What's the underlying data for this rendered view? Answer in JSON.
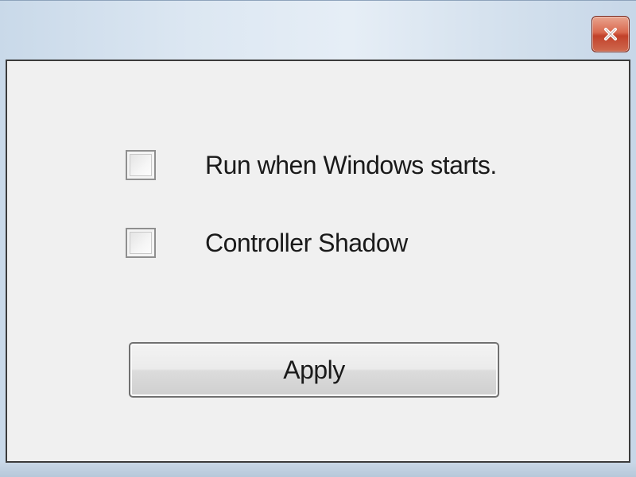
{
  "window": {
    "title": "",
    "close_icon": "close-icon"
  },
  "options": [
    {
      "label": "Run when Windows starts.",
      "checked": false
    },
    {
      "label": "Controller Shadow",
      "checked": false
    }
  ],
  "actions": {
    "apply_label": "Apply"
  },
  "colors": {
    "close_button": "#c9452e",
    "client_background": "#f0f0f0",
    "title_bar": "#dce7f2"
  }
}
